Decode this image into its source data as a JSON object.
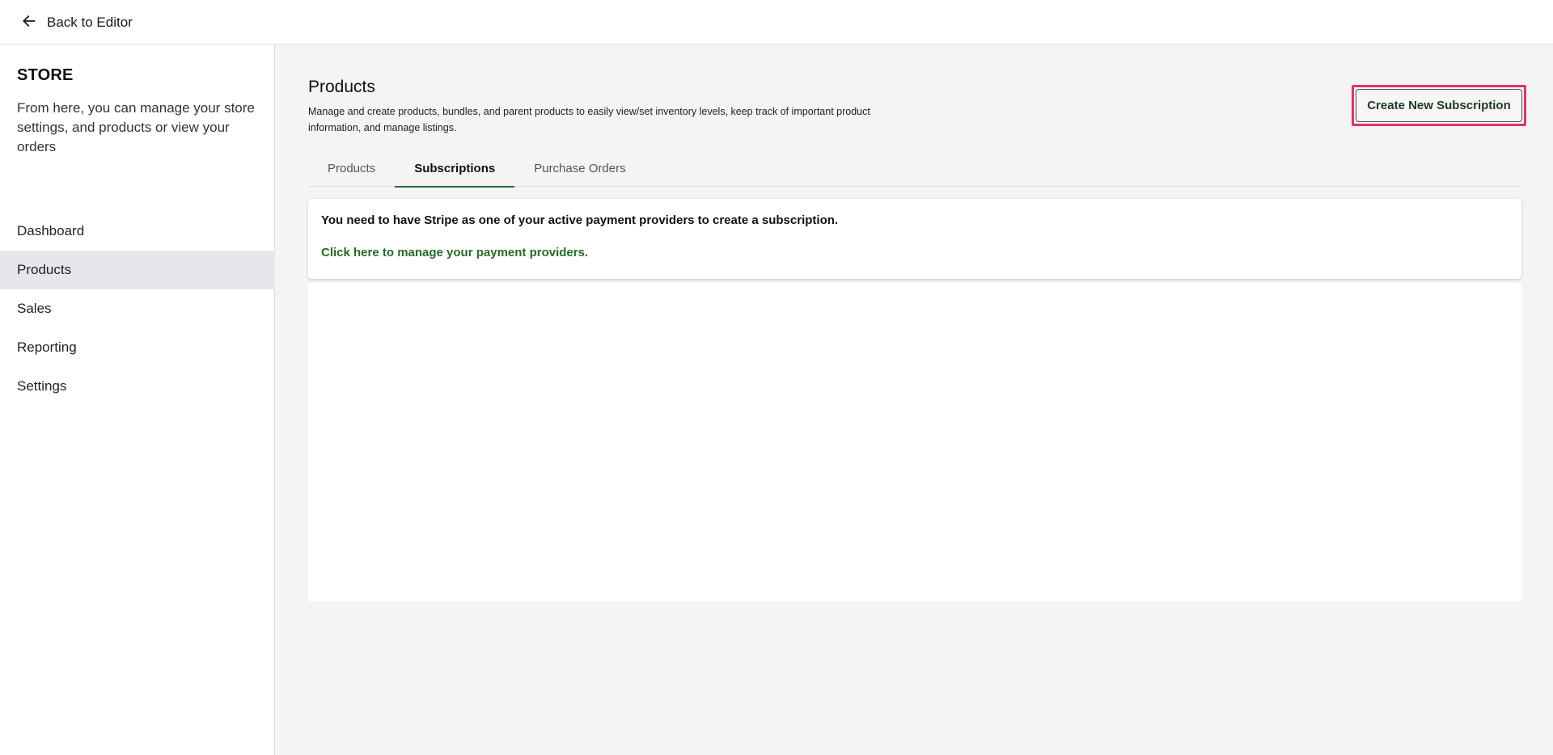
{
  "topbar": {
    "back_label": "Back to Editor",
    "back_icon": "arrow-left-icon"
  },
  "sidebar": {
    "title": "STORE",
    "description": "From here, you can manage your store settings, and products or view your orders",
    "items": [
      {
        "label": "Dashboard",
        "active": false
      },
      {
        "label": "Products",
        "active": true
      },
      {
        "label": "Sales",
        "active": false
      },
      {
        "label": "Reporting",
        "active": false
      },
      {
        "label": "Settings",
        "active": false
      }
    ]
  },
  "main": {
    "title": "Products",
    "description": "Manage and create products, bundles, and parent products to easily view/set inventory levels, keep track of important product information, and manage listings.",
    "create_button_label": "Create New Subscription",
    "tabs": [
      {
        "label": "Products",
        "active": false
      },
      {
        "label": "Subscriptions",
        "active": true
      },
      {
        "label": "Purchase Orders",
        "active": false
      }
    ],
    "notice": {
      "text": "You need to have Stripe as one of your active payment providers to create a subscription.",
      "link_label": "Click here to manage your payment providers."
    }
  },
  "colors": {
    "accent": "#2f6b3a",
    "link": "#246b25",
    "highlight": "#e6306d",
    "active_nav_bg": "#e6e7ea"
  }
}
